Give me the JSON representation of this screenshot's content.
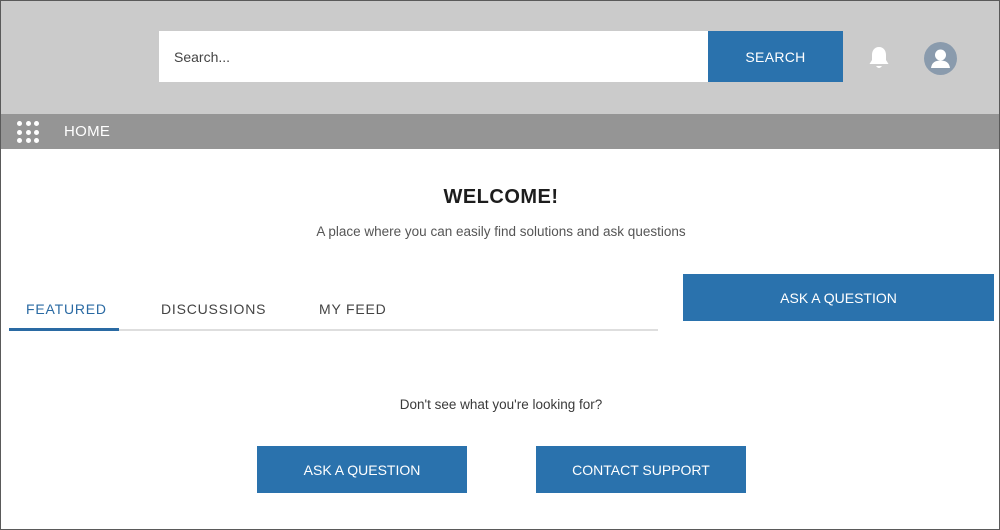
{
  "header": {
    "search": {
      "placeholder": "Search...",
      "value": ""
    },
    "search_button_label": "SEARCH",
    "notification_icon": "bell-icon",
    "avatar_icon": "user-avatar-icon"
  },
  "nav": {
    "launcher_icon": "app-launcher-grid-icon",
    "home_label": "HOME"
  },
  "welcome": {
    "title": "WELCOME!",
    "subtitle": "A place where you can easily find solutions and ask questions"
  },
  "tabs": [
    {
      "label": "FEATURED",
      "active": true
    },
    {
      "label": "DISCUSSIONS",
      "active": false
    },
    {
      "label": "MY FEED",
      "active": false
    }
  ],
  "ask_question_top_label": "ASK A QUESTION",
  "footer": {
    "prompt": "Don't see what you're looking for?",
    "ask_button_label": "ASK A QUESTION",
    "contact_button_label": "CONTACT SUPPORT"
  },
  "colors": {
    "header_bg": "#cbcbcb",
    "nav_bg": "#959595",
    "primary": "#2a72ad",
    "active_tab": "#2a6aa3"
  }
}
